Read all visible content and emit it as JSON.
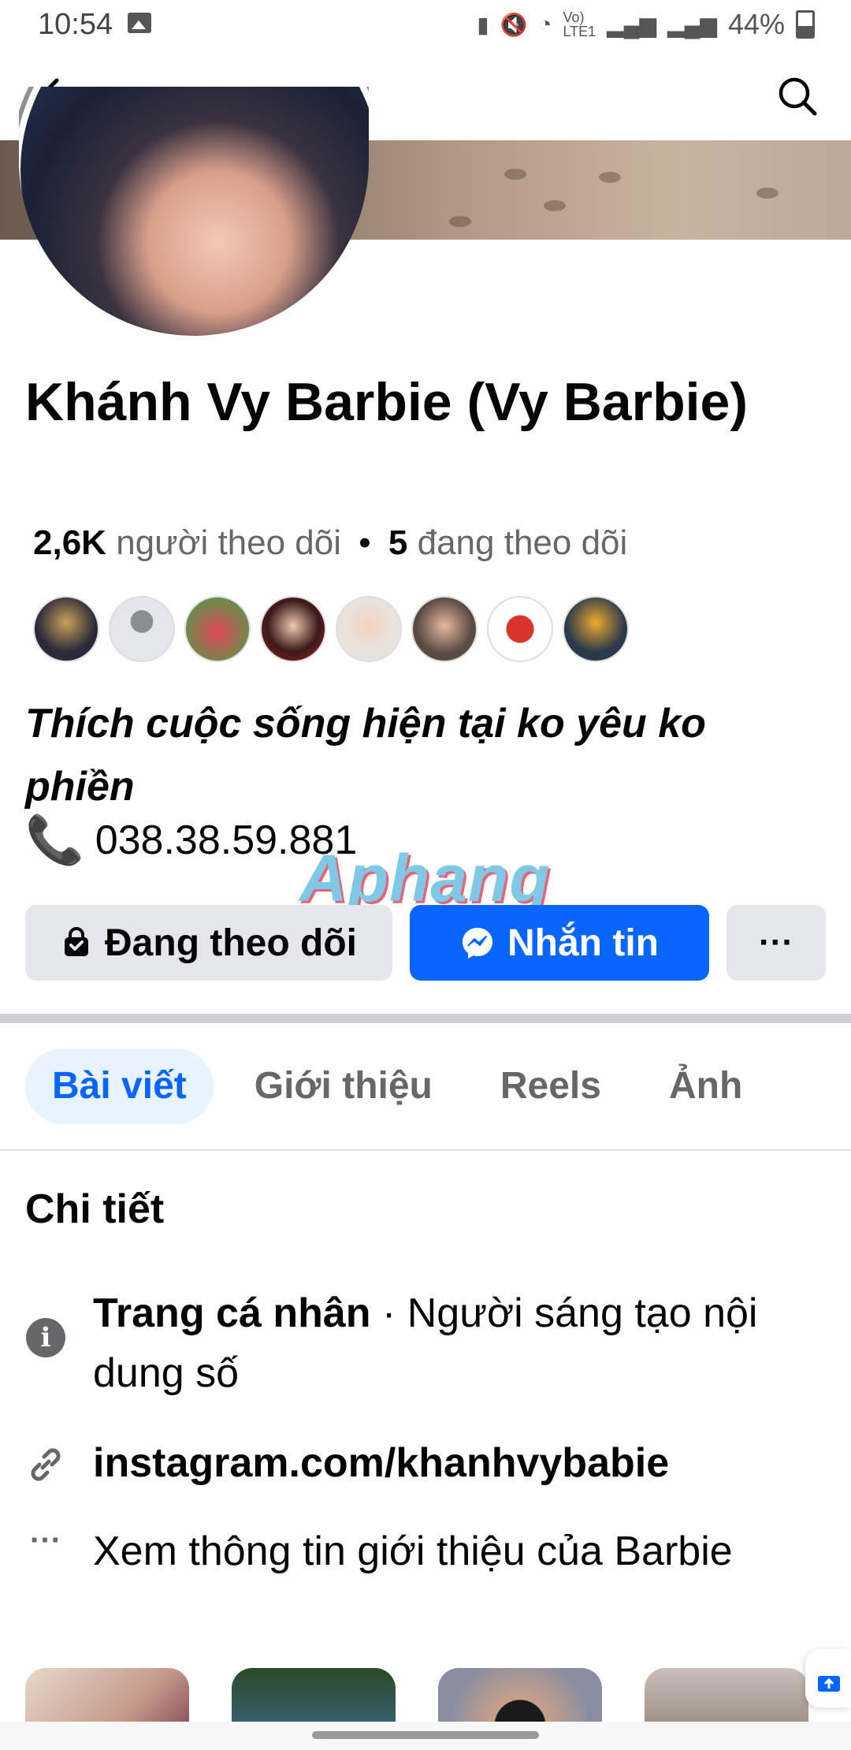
{
  "status_bar": {
    "time": "10:54",
    "battery": "44%"
  },
  "profile": {
    "name": "Khánh Vy Barbie (Vy Barbie)",
    "followers_count": "2,6K",
    "followers_label": "người theo dõi",
    "separator": "•",
    "following_count": "5",
    "following_label": "đang theo dõi",
    "bio": "Thích cuộc sống hiện tại ko yêu ko phiền",
    "phone": "038.38.59.881",
    "phone_icon": "📞"
  },
  "watermark": "Aphang",
  "actions": {
    "follow_label": "Đang theo dõi",
    "message_label": "Nhắn tin",
    "more_label": "···"
  },
  "tabs": [
    {
      "label": "Bài viết",
      "active": true
    },
    {
      "label": "Giới thiệu",
      "active": false
    },
    {
      "label": "Reels",
      "active": false
    },
    {
      "label": "Ảnh",
      "active": false
    }
  ],
  "details": {
    "title": "Chi tiết",
    "page_type_bold": "Trang cá nhân",
    "page_type_rest": " · Người sáng tạo nội dung số",
    "link": "instagram.com/khanhvybabie",
    "more_info": "Xem thông tin giới thiệu của Barbie",
    "more_icon": "···"
  },
  "colors": {
    "accent": "#0866ff",
    "button_gray": "#e4e6eb",
    "muted_text": "#65676b"
  },
  "icons": [
    "back-arrow-icon",
    "search-icon",
    "lock-bag-icon",
    "messenger-icon",
    "info-icon",
    "link-icon",
    "more-dots-icon"
  ]
}
